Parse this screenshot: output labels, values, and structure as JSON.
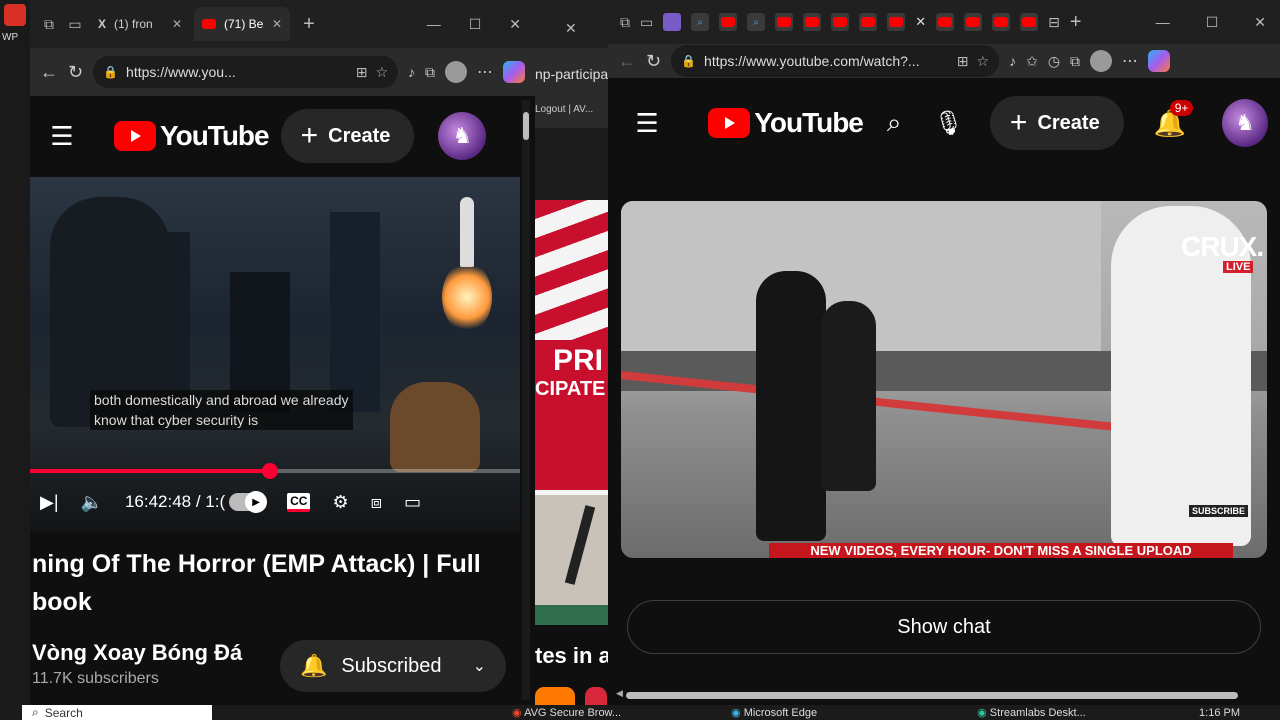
{
  "left_window": {
    "tabs": [
      {
        "label": "(1) fron"
      },
      {
        "label": "(71) Be"
      }
    ],
    "url": "https://www.you...",
    "youtube": {
      "logo_text": "YouTube",
      "create_label": "Create"
    },
    "video": {
      "caption_line1": "both domestically and abroad we already",
      "caption_line2": "know that cyber security is",
      "time_display": "16:42:48 / 1:(",
      "progress": 0.49,
      "title_line1": "ning Of The Horror (EMP Attack) | Full",
      "title_line2": "book",
      "channel_name": "Vòng Xoay Bóng Đá",
      "subscribers": "11.7K subscribers",
      "subscribed_label": "Subscribed",
      "cc_label": "CC"
    }
  },
  "middle_window": {
    "url_fragment": "np-participa",
    "logout_text": "Logout | AV...",
    "banner_line1": "PRI",
    "banner_line2": "CIPATE",
    "bottom_text": "tes in a"
  },
  "right_window": {
    "url": "https://www.youtube.com/watch?...",
    "youtube": {
      "logo_text": "YouTube",
      "create_label": "Create",
      "notification_badge": "9+"
    },
    "video": {
      "brand_text": "CRUX.",
      "live_badge": "LIVE",
      "subscribe_badge": "SUBSCRIBE",
      "ticker": "NEW VIDEOS, EVERY HOUR- DON'T MISS A SINGLE UPLOAD"
    },
    "show_chat_label": "Show chat"
  },
  "taskbar": {
    "search_label": "Search",
    "items": [
      {
        "label": "AVG Secure Brow..."
      },
      {
        "label": "Microsoft Edge"
      },
      {
        "label": "Streamlabs Deskt..."
      }
    ],
    "clock": "1:16 PM",
    "wp_label": "WP"
  },
  "colors": {
    "yt_red": "#ff0000",
    "progress_red": "#ff0033",
    "ticker_red": "#c4161c"
  }
}
